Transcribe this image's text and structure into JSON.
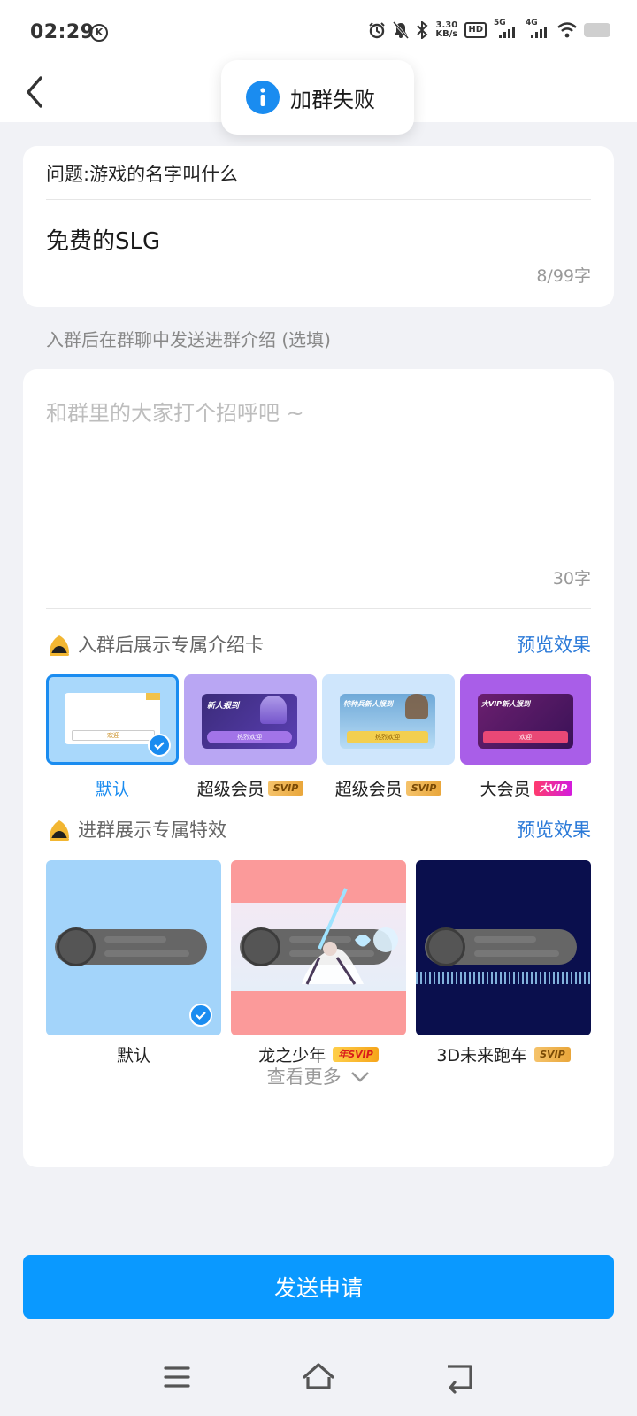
{
  "status_bar": {
    "time": "02:29",
    "k_badge": "K",
    "net_speed_value": "3.30",
    "net_speed_unit": "KB/s",
    "hd_label": "HD",
    "sim1_label": "5G",
    "sim2_label": "4G",
    "icons": [
      "alarm-icon",
      "mute-icon",
      "bluetooth-icon",
      "hd-icon",
      "signal-5g-icon",
      "signal-4g-icon",
      "wifi-icon",
      "battery-icon"
    ]
  },
  "toast": {
    "text": "加群失败",
    "icon": "info-icon"
  },
  "question_card": {
    "question": "问题:游戏的名字叫什么",
    "answer": "免费的SLG",
    "counter": "8/99字"
  },
  "intro": {
    "hint": "入群后在群聊中发送进群介绍 (选填)",
    "placeholder": "和群里的大家打个招呼吧 ~",
    "counter": "30字"
  },
  "intro_cards": {
    "title": "入群后展示专属介绍卡",
    "preview": "预览效果",
    "options": [
      {
        "label": "默认",
        "badge": "",
        "selected": true,
        "thumb_text": "欢迎",
        "thumb_btn": ""
      },
      {
        "label": "超级会员",
        "badge": "SVIP",
        "selected": false,
        "thumb_text": "新人报到",
        "thumb_btn": "热烈欢迎"
      },
      {
        "label": "超级会员",
        "badge": "SVIP",
        "selected": false,
        "thumb_text": "特种兵新人报到",
        "thumb_btn": "热烈欢迎"
      },
      {
        "label": "大会员",
        "badge": "大VIP",
        "selected": false,
        "thumb_text": "大VIP新人报到",
        "thumb_btn": "欢迎"
      }
    ]
  },
  "effects": {
    "title": "进群展示专属特效",
    "preview": "预览效果",
    "options": [
      {
        "label": "默认",
        "badge": "",
        "selected": true
      },
      {
        "label": "龙之少年",
        "badge": "年SVIP",
        "selected": false
      },
      {
        "label": "3D未来跑车",
        "badge": "SVIP",
        "selected": false
      }
    ],
    "see_more": "查看更多"
  },
  "submit": {
    "label": "发送申请"
  },
  "colors": {
    "accent": "#0a99ff",
    "link": "#2b7ad8",
    "page_bg": "#f1f2f6"
  },
  "navbar": {
    "icons": [
      "menu-icon",
      "home-icon",
      "back-icon"
    ]
  }
}
